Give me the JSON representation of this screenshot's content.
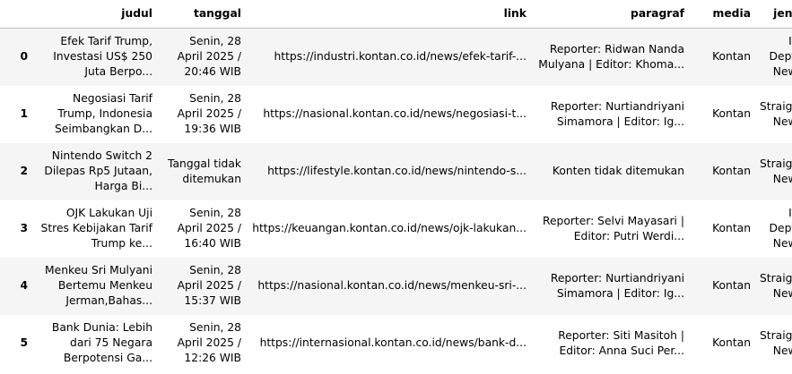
{
  "table": {
    "columns": [
      "",
      "judul",
      "tanggal",
      "link",
      "paragraf",
      "media",
      "jenis"
    ],
    "rows": [
      {
        "index": "0",
        "judul": "Efek Tarif Trump, Investasi US$ 250 Juta Berpo...",
        "tanggal": "Senin, 28 April 2025 / 20:46 WIB",
        "link": "https://industri.kontan.co.id/news/efek-tarif-...",
        "paragraf": "Reporter: Ridwan Nanda Mulyana | Editor: Khoma...",
        "media": "Kontan",
        "jenis": "In-Depth News"
      },
      {
        "index": "1",
        "judul": "Negosiasi Tarif Trump, Indonesia Seimbangkan D...",
        "tanggal": "Senin, 28 April 2025 / 19:36 WIB",
        "link": "https://nasional.kontan.co.id/news/negosiasi-t...",
        "paragraf": "Reporter: Nurtiandriyani Simamora | Editor: Ig...",
        "media": "Kontan",
        "jenis": "Straight News"
      },
      {
        "index": "2",
        "judul": "Nintendo Switch 2 Dilepas Rp5 Jutaan, Harga Bi...",
        "tanggal": "Tanggal tidak ditemukan",
        "link": "https://lifestyle.kontan.co.id/news/nintendo-s...",
        "paragraf": "Konten tidak ditemukan",
        "media": "Kontan",
        "jenis": "Straight News"
      },
      {
        "index": "3",
        "judul": "OJK Lakukan Uji Stres Kebijakan Tarif Trump ke...",
        "tanggal": "Senin, 28 April 2025 / 16:40 WIB",
        "link": "https://keuangan.kontan.co.id/news/ojk-lakukan...",
        "paragraf": "Reporter: Selvi Mayasari | Editor: Putri Werdi...",
        "media": "Kontan",
        "jenis": "In-Depth News"
      },
      {
        "index": "4",
        "judul": "Menkeu Sri Mulyani Bertemu Menkeu Jerman,Bahas...",
        "tanggal": "Senin, 28 April 2025 / 15:37 WIB",
        "link": "https://nasional.kontan.co.id/news/menkeu-sri-...",
        "paragraf": "Reporter: Nurtiandriyani Simamora | Editor: Ig...",
        "media": "Kontan",
        "jenis": "Straight News"
      },
      {
        "index": "5",
        "judul": "Bank Dunia: Lebih dari 75 Negara Berpotensi Ga...",
        "tanggal": "Senin, 28 April 2025 / 12:26 WIB",
        "link": "https://internasional.kontan.co.id/news/bank-d...",
        "paragraf": "Reporter: Siti Masitoh | Editor: Anna Suci Per...",
        "media": "Kontan",
        "jenis": "Straight News"
      }
    ]
  }
}
